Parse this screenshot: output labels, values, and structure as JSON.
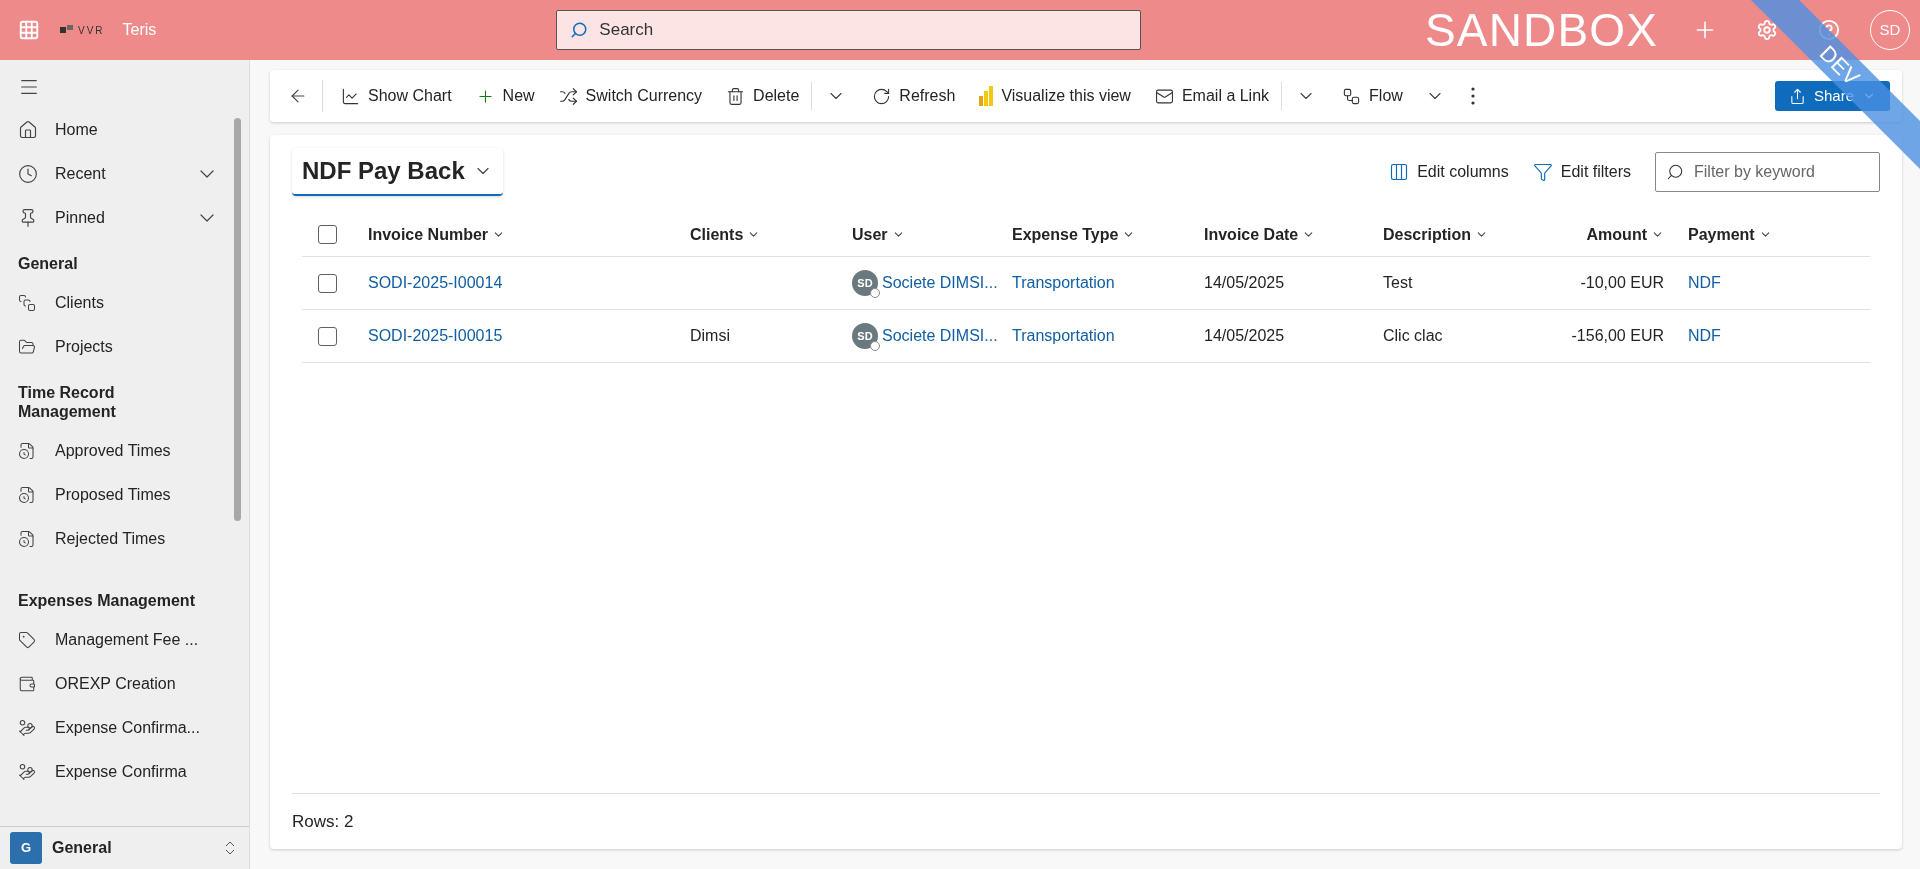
{
  "app_bar": {
    "logo_text": "VVR",
    "app_name": "Teris",
    "search": {
      "placeholder": "Search"
    },
    "environment": "SANDBOX",
    "avatar": "SD",
    "ribbon": "DEV"
  },
  "sidebar": {
    "top_items": [
      {
        "label": "Home",
        "expandable": false
      },
      {
        "label": "Recent",
        "expandable": true
      },
      {
        "label": "Pinned",
        "expandable": true
      }
    ],
    "groups": [
      {
        "title": "General",
        "items": [
          "Clients",
          "Projects"
        ]
      },
      {
        "title": "Time Record Management",
        "items": [
          "Approved Times",
          "Proposed Times",
          "Rejected Times"
        ]
      },
      {
        "title": "Expenses Management",
        "items": [
          "Management Fee ...",
          "OREXP Creation",
          "Expense Confirma...",
          "Expense Confirma"
        ]
      }
    ],
    "area": {
      "badge": "G",
      "label": "General"
    }
  },
  "command_bar": {
    "commands": [
      {
        "label": "Show Chart",
        "kind": "command"
      },
      {
        "label": "New",
        "kind": "command"
      },
      {
        "label": "Switch Currency",
        "kind": "command"
      },
      {
        "label": "Delete",
        "kind": "command"
      },
      {
        "kind": "overflow"
      },
      {
        "label": "Refresh",
        "kind": "command"
      },
      {
        "label": "Visualize this view",
        "kind": "command"
      },
      {
        "label": "Email a Link",
        "kind": "command"
      },
      {
        "kind": "overflow"
      },
      {
        "label": "Flow",
        "kind": "menu"
      },
      {
        "kind": "more"
      }
    ],
    "share": "Share"
  },
  "view": {
    "title": "NDF Pay Back",
    "actions": [
      "Edit columns",
      "Edit filters"
    ],
    "filter": {
      "placeholder": "Filter by keyword"
    },
    "select_all": {
      "checked": false
    },
    "columns": [
      {
        "label": "Invoice Number",
        "kind": "link"
      },
      {
        "label": "Clients",
        "kind": "text"
      },
      {
        "label": "User",
        "kind": "user"
      },
      {
        "label": "Expense Type",
        "kind": "link"
      },
      {
        "label": "Invoice Date",
        "kind": "text"
      },
      {
        "label": "Description",
        "kind": "text"
      },
      {
        "label": "Amount",
        "kind": "amount"
      },
      {
        "label": "Payment",
        "kind": "link"
      }
    ],
    "rows": [
      {
        "checked": false,
        "cells": [
          "SODI-2025-I00014",
          "",
          {
            "initials": "SD",
            "name": "Societe DIMSI..."
          },
          "Transportation",
          "14/05/2025",
          "Test",
          "-10,00 EUR",
          "NDF"
        ]
      },
      {
        "checked": false,
        "cells": [
          "SODI-2025-I00015",
          "Dimsi",
          {
            "initials": "SD",
            "name": "Societe DIMSI..."
          },
          "Transportation",
          "14/05/2025",
          "Clic clac",
          "-156,00 EUR",
          "NDF"
        ]
      }
    ],
    "footer": "Rows: 2"
  }
}
